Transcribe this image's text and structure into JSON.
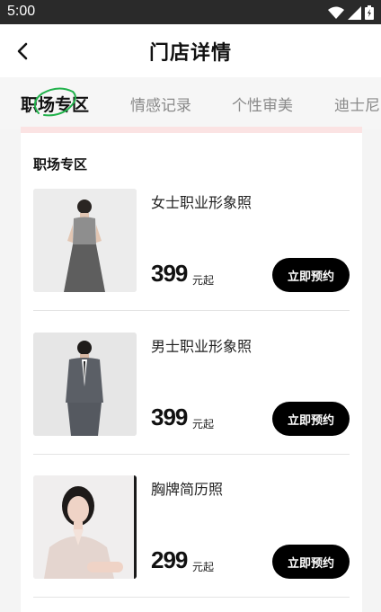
{
  "status_bar": {
    "time": "5:00"
  },
  "header": {
    "title": "门店详情"
  },
  "tabs": [
    {
      "label": "职场专区",
      "active": true
    },
    {
      "label": "情感记录",
      "active": false
    },
    {
      "label": "个性审美",
      "active": false
    },
    {
      "label": "迪士尼",
      "active": false
    }
  ],
  "section": {
    "title": "职场专区"
  },
  "items": [
    {
      "name": "女士职业形象照",
      "price": "399",
      "unit": "元起",
      "button": "立即预约"
    },
    {
      "name": "男士职业形象照",
      "price": "399",
      "unit": "元起",
      "button": "立即预约"
    },
    {
      "name": "胸牌简历照",
      "price": "299",
      "unit": "元起",
      "button": "立即预约"
    }
  ],
  "colors": {
    "accent_ring": "#22b24c",
    "button_bg": "#000000",
    "card_topline": "#fbe3e3"
  }
}
